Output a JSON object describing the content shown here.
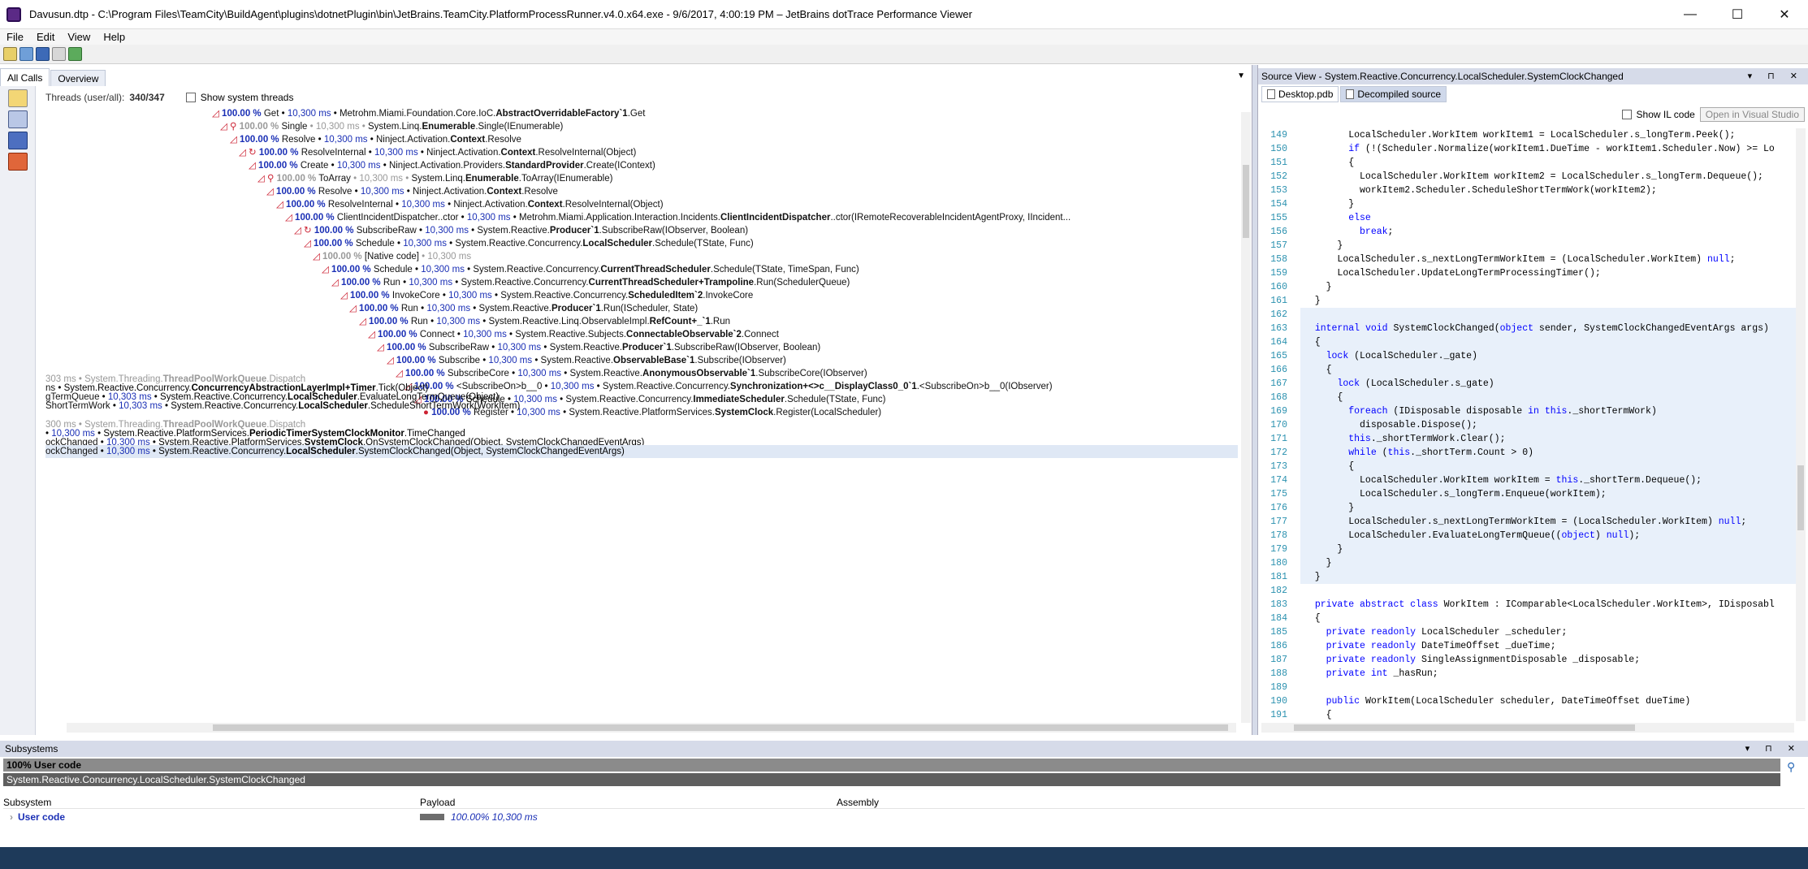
{
  "window": {
    "title": "Davusun.dtp - C:\\Program Files\\TeamCity\\BuildAgent\\plugins\\dotnetPlugin\\bin\\JetBrains.TeamCity.PlatformProcessRunner.v4.0.x64.exe - 9/6/2017, 4:00:19 PM – JetBrains dotTrace Performance Viewer",
    "minimize": "—",
    "maximize": "☐",
    "close": "✕"
  },
  "menu": [
    "File",
    "Edit",
    "View",
    "Help"
  ],
  "left_tabs": [
    "All Calls",
    "Overview"
  ],
  "threads": {
    "label": "Threads (user/all):",
    "value": "340/347",
    "show_system": "Show system threads"
  },
  "tree_rows": [
    {
      "indent": 205,
      "mark": "◿",
      "pct": "100.00 %",
      "name": "Get",
      "ms": "10,300 ms",
      "ns": "Metrohm.Miami.Foundation.Core.IoC.",
      "cls": "AbstractOverridableFactory`1",
      "method": ".Get",
      "gray": false
    },
    {
      "indent": 215,
      "mark": "◿ ⚲",
      "pct": "100.00 %",
      "name": "Single",
      "ms": "10,300 ms",
      "ns": "System.Linq.",
      "cls": "Enumerable",
      "method": ".Single(IEnumerable)",
      "gray": true
    },
    {
      "indent": 227,
      "mark": "◿",
      "pct": "100.00 %",
      "name": "Resolve",
      "ms": "10,300 ms",
      "ns": "Ninject.Activation.",
      "cls": "Context",
      "method": ".Resolve",
      "gray": false
    },
    {
      "indent": 238,
      "mark": "◿ ↻",
      "pct": "100.00 %",
      "name": "ResolveInternal",
      "ms": "10,300 ms",
      "ns": "Ninject.Activation.",
      "cls": "Context",
      "method": ".ResolveInternal(Object)",
      "gray": false
    },
    {
      "indent": 250,
      "mark": "◿",
      "pct": "100.00 %",
      "name": "Create",
      "ms": "10,300 ms",
      "ns": "Ninject.Activation.Providers.",
      "cls": "StandardProvider",
      "method": ".Create(IContext)",
      "gray": false
    },
    {
      "indent": 261,
      "mark": "◿ ⚲",
      "pct": "100.00 %",
      "name": "ToArray",
      "ms": "10,300 ms",
      "ns": "System.Linq.",
      "cls": "Enumerable",
      "method": ".ToArray(IEnumerable)",
      "gray": true
    },
    {
      "indent": 272,
      "mark": "◿",
      "pct": "100.00 %",
      "name": "Resolve",
      "ms": "10,300 ms",
      "ns": "Ninject.Activation.",
      "cls": "Context",
      "method": ".Resolve",
      "gray": false
    },
    {
      "indent": 284,
      "mark": "◿",
      "pct": "100.00 %",
      "name": "ResolveInternal",
      "ms": "10,300 ms",
      "ns": "Ninject.Activation.",
      "cls": "Context",
      "method": ".ResolveInternal(Object)",
      "gray": false
    },
    {
      "indent": 295,
      "mark": "◿",
      "pct": "100.00 %",
      "name": "ClientIncidentDispatcher..ctor",
      "ms": "10,300 ms",
      "ns": "Metrohm.Miami.Application.Interaction.Incidents.",
      "cls": "ClientIncidentDispatcher",
      "method": "..ctor(IRemoteRecoverableIncidentAgentProxy, IIncident...",
      "gray": false
    },
    {
      "indent": 306,
      "mark": "◿ ↻",
      "pct": "100.00 %",
      "name": "SubscribeRaw",
      "ms": "10,300 ms",
      "ns": "System.Reactive.",
      "cls": "Producer`1",
      "method": ".SubscribeRaw(IObserver, Boolean)",
      "gray": false
    },
    {
      "indent": 318,
      "mark": "◿",
      "pct": "100.00 %",
      "name": "Schedule",
      "ms": "10,300 ms",
      "ns": "System.Reactive.Concurrency.",
      "cls": "LocalScheduler",
      "method": ".Schedule(TState, Func)",
      "gray": false
    },
    {
      "indent": 329,
      "mark": "◿",
      "pct": "100.00 %",
      "name": "[Native code]",
      "ms": "10,300 ms",
      "ns": "",
      "cls": "",
      "method": "",
      "gray": true
    },
    {
      "indent": 340,
      "mark": "◿",
      "pct": "100.00 %",
      "name": "Schedule",
      "ms": "10,300 ms",
      "ns": "System.Reactive.Concurrency.",
      "cls": "CurrentThreadScheduler",
      "method": ".Schedule(TState, TimeSpan, Func)",
      "gray": false
    },
    {
      "indent": 352,
      "mark": "◿",
      "pct": "100.00 %",
      "name": "Run",
      "ms": "10,300 ms",
      "ns": "System.Reactive.Concurrency.",
      "cls": "CurrentThreadScheduler+Trampoline",
      "method": ".Run(SchedulerQueue)",
      "gray": false
    },
    {
      "indent": 363,
      "mark": "◿",
      "pct": "100.00 %",
      "name": "InvokeCore",
      "ms": "10,300 ms",
      "ns": "System.Reactive.Concurrency.",
      "cls": "ScheduledItem`2",
      "method": ".InvokeCore",
      "gray": false
    },
    {
      "indent": 374,
      "mark": "◿",
      "pct": "100.00 %",
      "name": "Run",
      "ms": "10,300 ms",
      "ns": "System.Reactive.",
      "cls": "Producer`1",
      "method": ".Run(IScheduler, State)",
      "gray": false
    },
    {
      "indent": 386,
      "mark": "◿",
      "pct": "100.00 %",
      "name": "Run",
      "ms": "10,300 ms",
      "ns": "System.Reactive.Linq.ObservableImpl.",
      "cls": "RefCount+_`1",
      "method": ".Run",
      "gray": false
    },
    {
      "indent": 397,
      "mark": "◿",
      "pct": "100.00 %",
      "name": "Connect",
      "ms": "10,300 ms",
      "ns": "System.Reactive.Subjects.",
      "cls": "ConnectableObservable`2",
      "method": ".Connect",
      "gray": false
    },
    {
      "indent": 408,
      "mark": "◿",
      "pct": "100.00 %",
      "name": "SubscribeRaw",
      "ms": "10,300 ms",
      "ns": "System.Reactive.",
      "cls": "Producer`1",
      "method": ".SubscribeRaw(IObserver, Boolean)",
      "gray": false
    },
    {
      "indent": 420,
      "mark": "◿",
      "pct": "100.00 %",
      "name": "Subscribe",
      "ms": "10,300 ms",
      "ns": "System.Reactive.",
      "cls": "ObservableBase`1",
      "method": ".Subscribe(IObserver)",
      "gray": false
    },
    {
      "indent": 431,
      "mark": "◿",
      "pct": "100.00 %",
      "name": "SubscribeCore",
      "ms": "10,300 ms",
      "ns": "System.Reactive.",
      "cls": "AnonymousObservable`1",
      "method": ".SubscribeCore(IObserver)",
      "gray": false
    },
    {
      "indent": 442,
      "mark": "◿",
      "pct": "100.00 %",
      "name": "<SubscribeOn>b__0",
      "ms": "10,300 ms",
      "ns": "System.Reactive.Concurrency.",
      "cls": "Synchronization+<>c__DisplayClass0_0`1",
      "method": ".<SubscribeOn>b__0(IObserver)",
      "gray": false
    },
    {
      "indent": 454,
      "mark": "◿",
      "pct": "100.00 %",
      "name": "Schedule",
      "ms": "10,300 ms",
      "ns": "System.Reactive.Concurrency.",
      "cls": "ImmediateScheduler",
      "method": ".Schedule(TState, Func)",
      "gray": false
    },
    {
      "indent": 465,
      "mark": "●",
      "pct": "100.00 %",
      "name": "Register",
      "ms": "10,300 ms",
      "ns": "System.Reactive.PlatformServices.",
      "cls": "SystemClock",
      "method": ".Register(LocalScheduler)",
      "gray": false
    }
  ],
  "lower_rows": [
    {
      "text_a": "303 ms",
      "ns": "System.Threading.",
      "cls": "ThreadPoolWorkQueue",
      "method": ".Dispatch",
      "gray": true
    },
    {
      "text_a": "ns",
      "ns": "System.Reactive.Concurrency.",
      "cls": "ConcurrencyAbstractionLayerImpl+Timer",
      "method": ".Tick(Object)",
      "gray": false
    },
    {
      "text_a": "gTermQueue",
      "ms": "10,303 ms",
      "ns": "System.Reactive.Concurrency.",
      "cls": "LocalScheduler",
      "method": ".EvaluateLongTermQueue(Object)",
      "gray": false
    },
    {
      "text_a": "ShortTermWork",
      "ms": "10,303 ms",
      "ns": "System.Reactive.Concurrency.",
      "cls": "LocalScheduler",
      "method": ".ScheduleShortTermWork(WorkItem)",
      "gray": false
    },
    {
      "text_a": "300 ms",
      "ns": "System.Threading.",
      "cls": "ThreadPoolWorkQueue",
      "method": ".Dispatch",
      "gray": true
    },
    {
      "text_a": "",
      "ms": "10,300 ms",
      "ns": "System.Reactive.PlatformServices.",
      "cls": "PeriodicTimerSystemClockMonitor",
      "method": ".TimeChanged",
      "gray": false
    },
    {
      "text_a": "ockChanged",
      "ms": "10,300 ms",
      "ns": "System.Reactive.PlatformServices.",
      "cls": "SystemClock",
      "method": ".OnSystemClockChanged(Object, SystemClockChangedEventArgs)",
      "gray": false
    },
    {
      "text_a": "ockChanged",
      "ms": "10,300 ms",
      "ns": "System.Reactive.Concurrency.",
      "cls": "LocalScheduler",
      "method": ".SystemClockChanged(Object, SystemClockChangedEventArgs)",
      "gray": false
    }
  ],
  "source": {
    "header": "Source View - System.Reactive.Concurrency.LocalScheduler.SystemClockChanged",
    "tabs": [
      "Desktop.pdb",
      "Decompiled source"
    ],
    "show_il": "Show IL code",
    "open_vs": "Open in Visual Studio",
    "lines": [
      {
        "n": "149",
        "t": "        LocalScheduler.WorkItem workItem1 = LocalScheduler.s_longTerm.Peek();"
      },
      {
        "n": "150",
        "t": "        if (!(Scheduler.Normalize(workItem1.DueTime - workItem1.Scheduler.Now) >= Lo"
      },
      {
        "n": "151",
        "t": "        {"
      },
      {
        "n": "152",
        "t": "          LocalScheduler.WorkItem workItem2 = LocalScheduler.s_longTerm.Dequeue();"
      },
      {
        "n": "153",
        "t": "          workItem2.Scheduler.ScheduleShortTermWork(workItem2);"
      },
      {
        "n": "154",
        "t": "        }"
      },
      {
        "n": "155",
        "t": "        else"
      },
      {
        "n": "156",
        "t": "          break;"
      },
      {
        "n": "157",
        "t": "      }"
      },
      {
        "n": "158",
        "t": "      LocalScheduler.s_nextLongTermWorkItem = (LocalScheduler.WorkItem) null;"
      },
      {
        "n": "159",
        "t": "      LocalScheduler.UpdateLongTermProcessingTimer();"
      },
      {
        "n": "160",
        "t": "    }"
      },
      {
        "n": "161",
        "t": "  }"
      },
      {
        "n": "162",
        "t": ""
      },
      {
        "n": "163",
        "t": "  internal void SystemClockChanged(object sender, SystemClockChangedEventArgs args)"
      },
      {
        "n": "164",
        "t": "  {"
      },
      {
        "n": "165",
        "t": "    lock (LocalScheduler._gate)"
      },
      {
        "n": "166",
        "t": "    {"
      },
      {
        "n": "167",
        "t": "      lock (LocalScheduler.s_gate)"
      },
      {
        "n": "168",
        "t": "      {"
      },
      {
        "n": "169",
        "t": "        foreach (IDisposable disposable in this._shortTermWork)"
      },
      {
        "n": "170",
        "t": "          disposable.Dispose();"
      },
      {
        "n": "171",
        "t": "        this._shortTermWork.Clear();"
      },
      {
        "n": "172",
        "t": "        while (this._shortTerm.Count > 0)"
      },
      {
        "n": "173",
        "t": "        {"
      },
      {
        "n": "174",
        "t": "          LocalScheduler.WorkItem workItem = this._shortTerm.Dequeue();"
      },
      {
        "n": "175",
        "t": "          LocalScheduler.s_longTerm.Enqueue(workItem);"
      },
      {
        "n": "176",
        "t": "        }"
      },
      {
        "n": "177",
        "t": "        LocalScheduler.s_nextLongTermWorkItem = (LocalScheduler.WorkItem) null;"
      },
      {
        "n": "178",
        "t": "        LocalScheduler.EvaluateLongTermQueue((object) null);"
      },
      {
        "n": "179",
        "t": "      }"
      },
      {
        "n": "180",
        "t": "    }"
      },
      {
        "n": "181",
        "t": "  }"
      },
      {
        "n": "182",
        "t": ""
      },
      {
        "n": "183",
        "t": "  private abstract class WorkItem : IComparable<LocalScheduler.WorkItem>, IDisposabl"
      },
      {
        "n": "184",
        "t": "  {"
      },
      {
        "n": "185",
        "t": "    private readonly LocalScheduler _scheduler;"
      },
      {
        "n": "186",
        "t": "    private readonly DateTimeOffset _dueTime;"
      },
      {
        "n": "187",
        "t": "    private readonly SingleAssignmentDisposable _disposable;"
      },
      {
        "n": "188",
        "t": "    private int _hasRun;"
      },
      {
        "n": "189",
        "t": ""
      },
      {
        "n": "190",
        "t": "    public WorkItem(LocalScheduler scheduler, DateTimeOffset dueTime)"
      },
      {
        "n": "191",
        "t": "    {"
      }
    ]
  },
  "subsystems": {
    "header": "Subsystems",
    "code_row": "100% User code",
    "path_row": "System.Reactive.Concurrency.LocalScheduler.SystemClockChanged",
    "cols": [
      "Subsystem",
      "Payload",
      "Assembly"
    ],
    "row": {
      "name": "User code",
      "payload": "100.00% 10,300 ms"
    }
  }
}
